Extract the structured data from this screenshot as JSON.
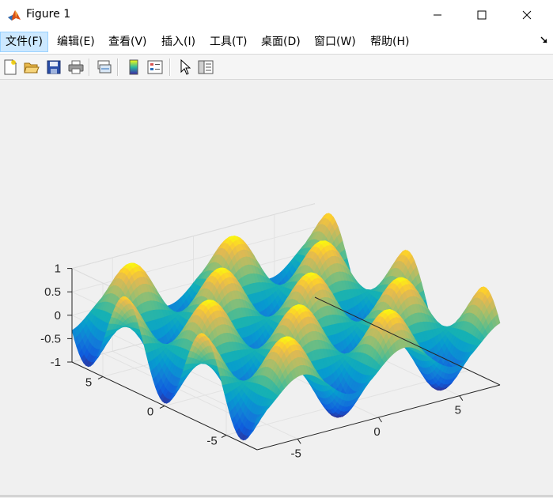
{
  "window": {
    "title": "Figure 1",
    "icon": "matlab-icon",
    "controls": [
      "minimize-icon",
      "maximize-icon",
      "close-icon"
    ]
  },
  "menu": {
    "items": [
      {
        "label": "文件(F)",
        "active": true
      },
      {
        "label": "编辑(E)"
      },
      {
        "label": "查看(V)"
      },
      {
        "label": "插入(I)"
      },
      {
        "label": "工具(T)"
      },
      {
        "label": "桌面(D)"
      },
      {
        "label": "窗口(W)"
      },
      {
        "label": "帮助(H)"
      }
    ],
    "corner_icon": "dock-arrow-icon"
  },
  "toolbar": {
    "buttons": [
      "new-figure-icon",
      "open-file-icon",
      "save-icon",
      "print-icon",
      "link-plot-icon",
      "insert-colorbar-icon",
      "insert-legend-icon",
      "edit-plot-icon",
      "property-inspector-icon"
    ]
  },
  "chart_data": {
    "type": "surface",
    "title": "",
    "function": "z = sin(x) * cos(y)",
    "colormap": "parula",
    "xlim": [
      -7.5,
      7.5
    ],
    "ylim": [
      -7.5,
      7.5
    ],
    "zlim": [
      -1,
      1
    ],
    "x_ticks": [
      "-5",
      "0",
      "5"
    ],
    "y_ticks": [
      "-5",
      "0",
      "5"
    ],
    "z_ticks": [
      "1",
      "0.5",
      "0",
      "-0.5",
      "-1"
    ],
    "grid": true,
    "view": "3d"
  }
}
